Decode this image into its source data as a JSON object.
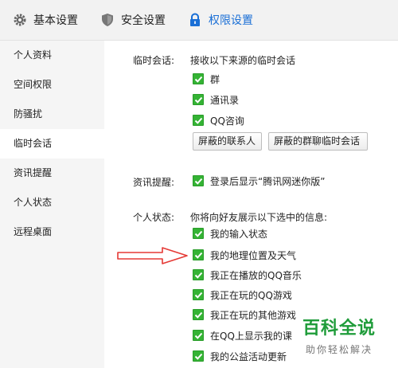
{
  "top_tabs": [
    {
      "label": "基本设置",
      "icon": "gear-icon"
    },
    {
      "label": "安全设置",
      "icon": "shield-icon"
    },
    {
      "label": "权限设置",
      "icon": "lock-icon"
    }
  ],
  "sidebar": {
    "items": [
      {
        "label": "个人资料"
      },
      {
        "label": "空间权限"
      },
      {
        "label": "防骚扰"
      },
      {
        "label": "临时会话"
      },
      {
        "label": "资讯提醒"
      },
      {
        "label": "个人状态"
      },
      {
        "label": "远程桌面"
      }
    ],
    "active_index": 3
  },
  "temp_chat": {
    "label": "临时会话:",
    "desc": "接收以下来源的临时会话",
    "options": [
      {
        "label": "群",
        "checked": true
      },
      {
        "label": "通讯录",
        "checked": true
      },
      {
        "label": "QQ咨询",
        "checked": true
      }
    ],
    "buttons": {
      "blocked_contacts": "屏蔽的联系人",
      "blocked_group_chat": "屏蔽的群聊临时会话"
    }
  },
  "news": {
    "label": "资讯提醒:",
    "option": {
      "label": "登录后显示“腾讯网迷你版”",
      "checked": true
    }
  },
  "status": {
    "label": "个人状态:",
    "desc": "你将向好友展示以下选中的信息:",
    "options": [
      {
        "label": "我的输入状态",
        "checked": true
      },
      {
        "label": "我的地理位置及天气",
        "checked": true
      },
      {
        "label": "我正在播放的QQ音乐",
        "checked": true
      },
      {
        "label": "我正在玩的QQ游戏",
        "checked": true
      },
      {
        "label": "我正在玩的其他游戏",
        "checked": true
      },
      {
        "label": "在QQ上显示我的课",
        "checked": true
      },
      {
        "label": "我的公益活动更新",
        "checked": true
      }
    ]
  },
  "watermark": {
    "main": "百科全说",
    "sub": "助你轻松解决"
  },
  "colors": {
    "accent": "#1a6fd6",
    "check": "#34b334",
    "arrow": "#e53935",
    "watermark": "#1f9c3a"
  }
}
